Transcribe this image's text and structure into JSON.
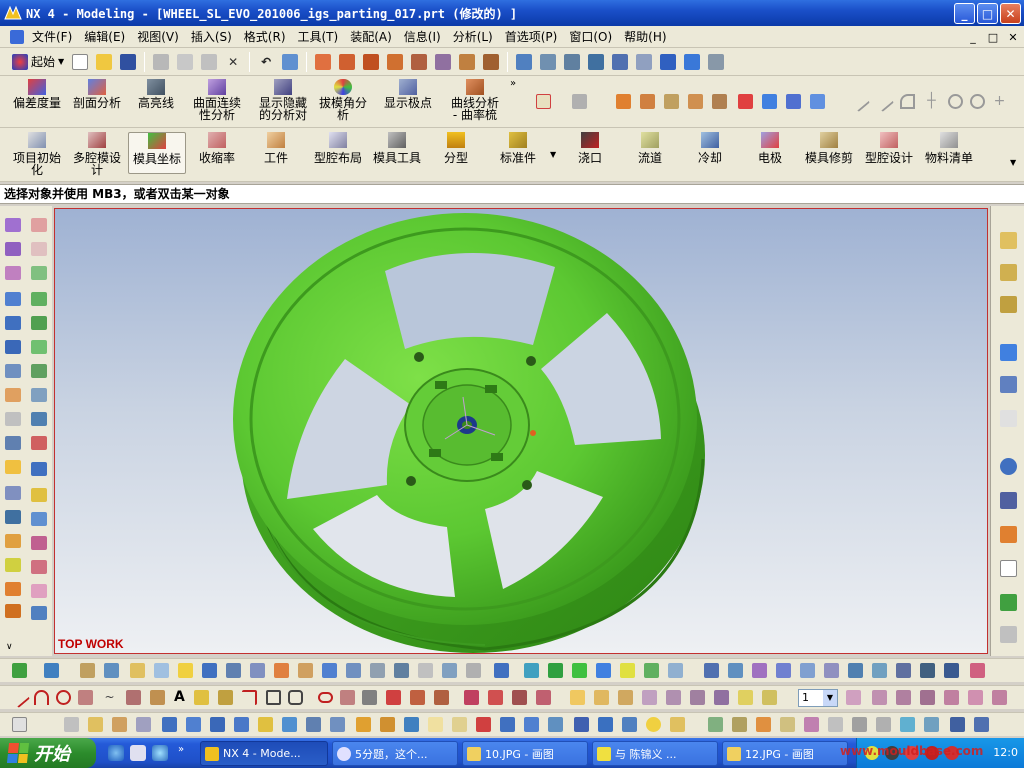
{
  "window": {
    "title": "NX 4 - Modeling - [WHEEL_SL_EVO_201006_igs_parting_017.prt  (修改的) ]",
    "buttons": {
      "minimize": "_",
      "maximize": "□",
      "close": "✕"
    }
  },
  "menubar": {
    "items": [
      "文件(F)",
      "编辑(E)",
      "视图(V)",
      "插入(S)",
      "格式(R)",
      "工具(T)",
      "装配(A)",
      "信息(I)",
      "分析(L)",
      "首选项(P)",
      "窗口(O)",
      "帮助(H)"
    ],
    "mdi_buttons": [
      "_",
      "□",
      "✕"
    ]
  },
  "standard_toolbar": {
    "start_label": "起始"
  },
  "analysis_toolbar": {
    "items": [
      "偏差度量",
      "剖面分析",
      "高亮线",
      "曲面连续\n性分析",
      "显示隐藏\n的分析对",
      "拔模角分\n析",
      "显示极点",
      "曲线分析\n- 曲率梳"
    ]
  },
  "mold_toolbar": {
    "items": [
      "项目初始\n化",
      "多腔模设\n计",
      "模具坐标",
      "收缩率",
      "工件",
      "型腔布局",
      "模具工具",
      "分型",
      "标准件",
      "浇口",
      "流道",
      "冷却",
      "电极",
      "模具修剪",
      "型腔设计",
      "物料清单"
    ]
  },
  "cue_line": {
    "text": "选择对象并使用 MB3，或者双击某一对象"
  },
  "viewport": {
    "view_name": "TOP WORK",
    "model_color": "#5cc832"
  },
  "bottom_toolbar": {
    "text_tool": "A",
    "zoom_value": "1"
  },
  "taskbar": {
    "start_label": "开始",
    "tasks": [
      "NX 4 - Mode...",
      "5分题，这个...",
      "10.JPG - 画图",
      "与 陈锦义 ...",
      "12.JPG - 画图"
    ],
    "clock": "12:0"
  },
  "watermark": "www.mouldbase.com"
}
